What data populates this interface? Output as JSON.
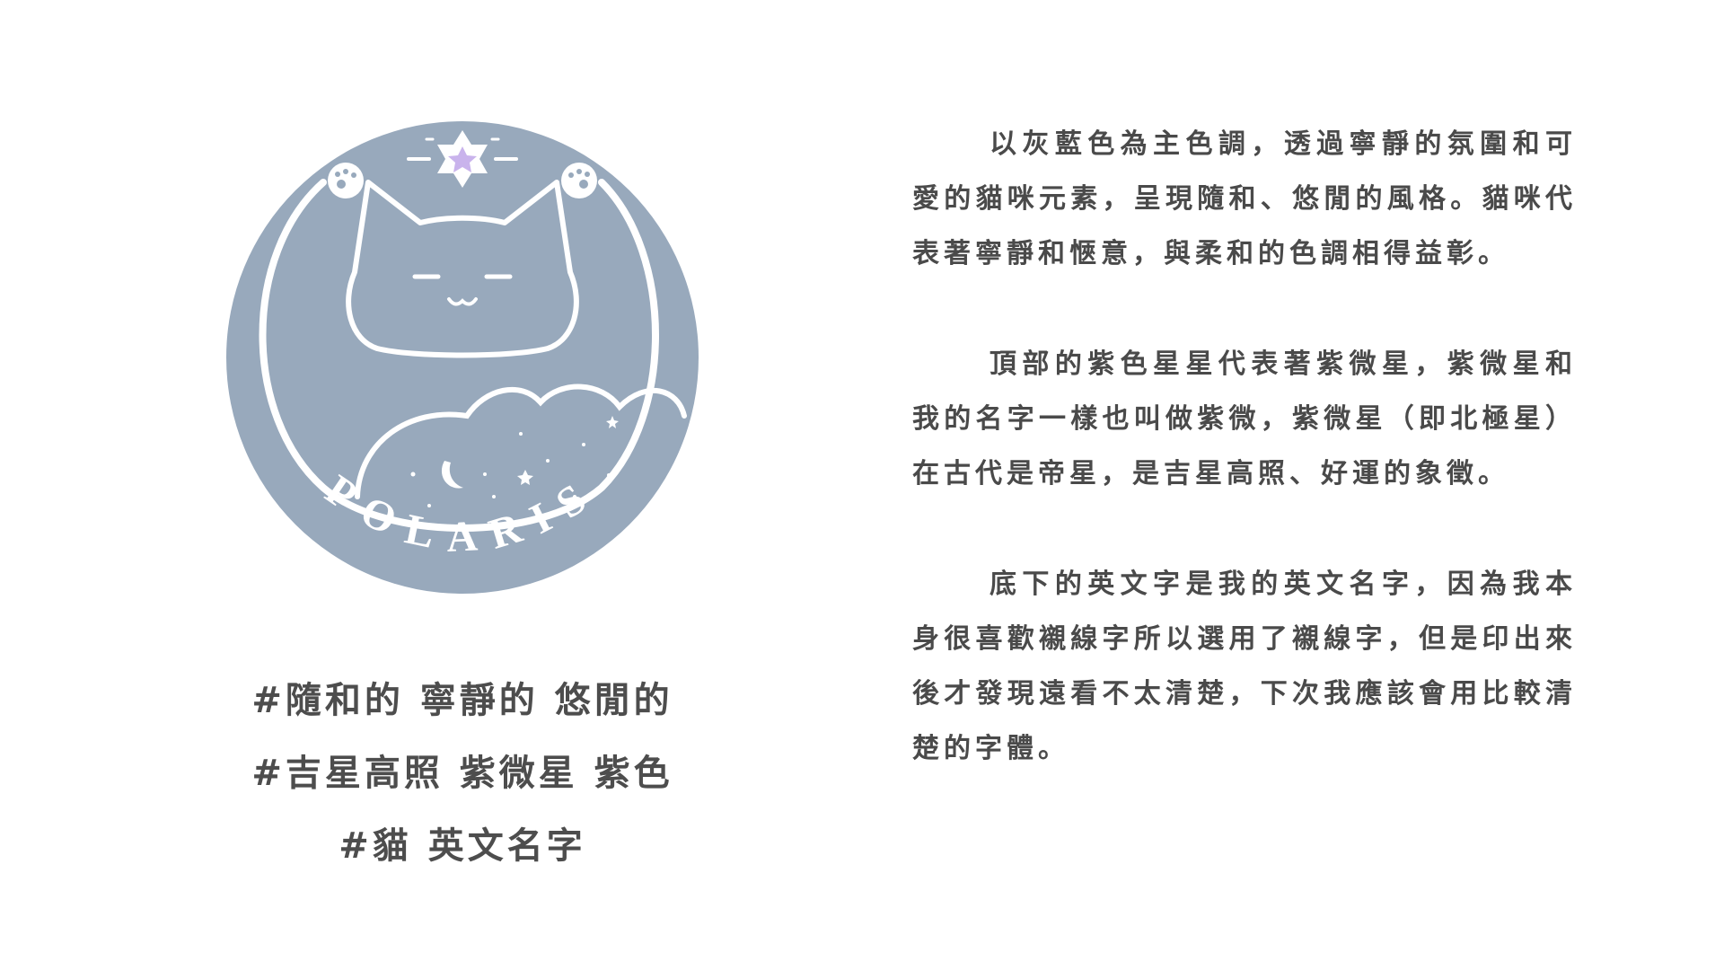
{
  "logo": {
    "wordmark": "POLARIS",
    "colors": {
      "circle": "#98a9bc",
      "line": "#ffffff",
      "star": "#c9b3ec"
    }
  },
  "tags": {
    "line1": "#隨和的 寧靜的 悠閒的",
    "line2": "#吉星高照 紫微星 紫色",
    "line3": "#貓 英文名字"
  },
  "description": {
    "paragraphs": [
      "以灰藍色為主色調，透過寧靜的氛圍和可愛的貓咪元素，呈現隨和、悠閒的風格。貓咪代表著寧靜和愜意，與柔和的色調相得益彰。",
      "頂部的紫色星星代表著紫微星，紫微星和我的名字一樣也叫做紫微，紫微星（即北極星）在古代是帝星，是吉星高照、好運的象徵。",
      "底下的英文字是我的英文名字，因為我本身很喜歡襯線字所以選用了襯線字，但是印出來後才發現遠看不太清楚，下次我應該會用比較清楚的字體。"
    ]
  }
}
